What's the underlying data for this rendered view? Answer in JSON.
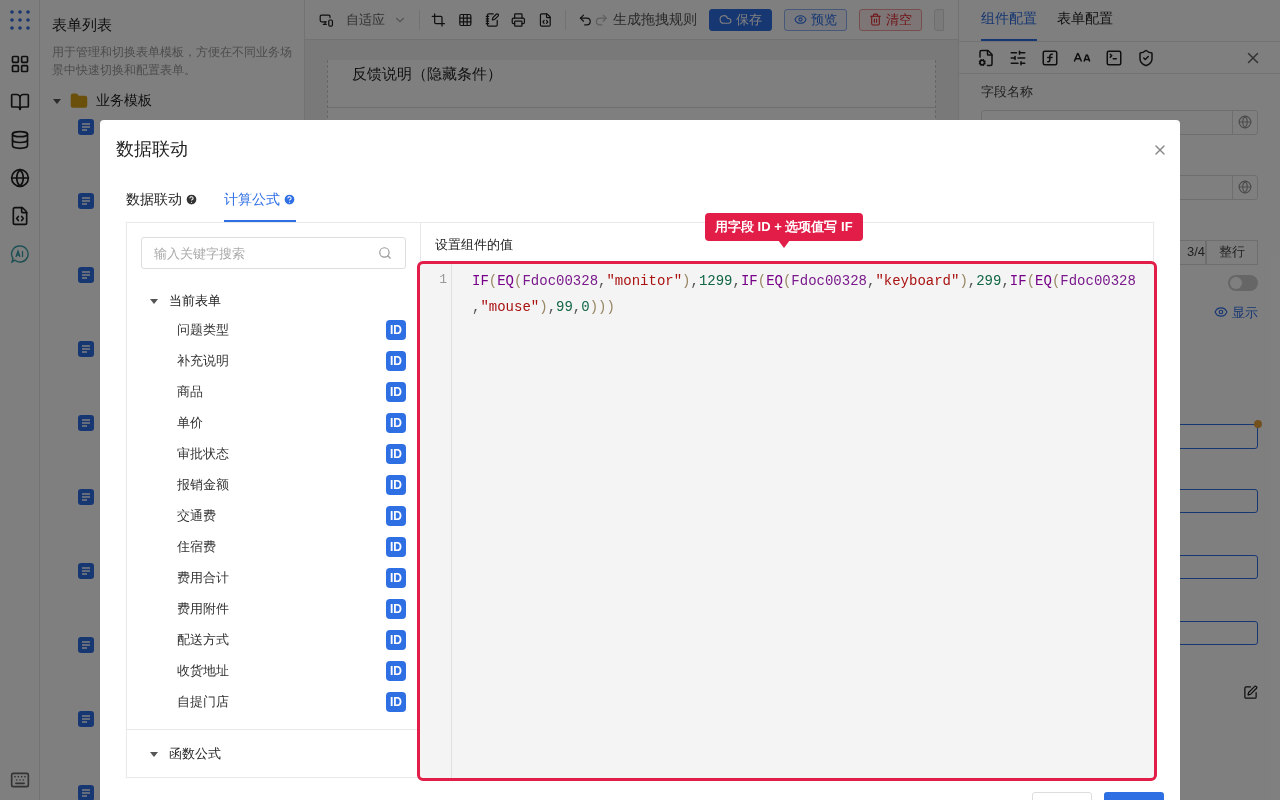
{
  "sidebar": {
    "title": "表单列表",
    "description": "用于管理和切换表单模板，方便在不同业务场景中快速切换和配置表单。",
    "tree": [
      {
        "label": "业务模板",
        "expanded": true,
        "children": [
          {
            "kind": "form"
          },
          {
            "kind": "form"
          },
          {
            "kind": "form"
          },
          {
            "kind": "form"
          },
          {
            "kind": "form"
          },
          {
            "kind": "form"
          },
          {
            "kind": "form"
          },
          {
            "kind": "form"
          },
          {
            "kind": "form"
          },
          {
            "kind": "form"
          }
        ]
      }
    ]
  },
  "toolbar": {
    "viewport": "自适应",
    "redo": {
      "disabled": true
    },
    "generate_rules": "生成拖拽规则",
    "buttons": [
      {
        "label": "保存",
        "kind": "primary"
      },
      {
        "label": "预览",
        "kind": "outline"
      },
      {
        "label": "清空",
        "kind": "danger"
      }
    ]
  },
  "canvas": {
    "field_title": "反馈说明（隐藏条件）"
  },
  "config_panel": {
    "tabs": [
      {
        "label": "组件配置",
        "selected": true
      },
      {
        "label": "表单配置",
        "selected": false
      }
    ],
    "field_name_label": "字段名称",
    "width_options": [
      {
        "label": "3/4",
        "selected": false
      },
      {
        "label": "整行",
        "selected": false
      }
    ],
    "toggle": {
      "on": false
    },
    "visibility_link": "显示"
  },
  "dialog": {
    "title": "数据联动",
    "tabs": [
      {
        "label": "数据联动",
        "selected": false
      },
      {
        "label": "计算公式",
        "selected": true
      }
    ],
    "search": {
      "placeholder": "输入关键字搜索"
    },
    "groups": [
      {
        "label": "当前表单",
        "expanded": true,
        "children": [
          {
            "label": "问题类型",
            "badge": "ID"
          },
          {
            "label": "补充说明",
            "badge": "ID"
          },
          {
            "label": "商品",
            "badge": "ID"
          },
          {
            "label": "单价",
            "badge": "ID"
          },
          {
            "label": "审批状态",
            "badge": "ID"
          },
          {
            "label": "报销金额",
            "badge": "ID"
          },
          {
            "label": "交通费",
            "badge": "ID"
          },
          {
            "label": "住宿费",
            "badge": "ID"
          },
          {
            "label": "费用合计",
            "badge": "ID"
          },
          {
            "label": "费用附件",
            "badge": "ID"
          },
          {
            "label": "配送方式",
            "badge": "ID"
          },
          {
            "label": "收货地址",
            "badge": "ID"
          },
          {
            "label": "自提门店",
            "badge": "ID"
          }
        ]
      },
      {
        "label": "函数公式",
        "expanded": true
      }
    ],
    "editor": {
      "label": "设置组件的值",
      "line_numbers": [
        "1"
      ],
      "tokens": [
        {
          "kind": "function",
          "text": "IF"
        },
        {
          "kind": "paren",
          "text": "("
        },
        {
          "kind": "function",
          "text": "EQ"
        },
        {
          "kind": "paren",
          "text": "("
        },
        {
          "kind": "field",
          "text": "Fdoc00328"
        },
        {
          "kind": "punct",
          "text": ","
        },
        {
          "kind": "string",
          "text": "\"monitor\""
        },
        {
          "kind": "paren",
          "text": ")"
        },
        {
          "kind": "punct",
          "text": ","
        },
        {
          "kind": "number",
          "text": "1299"
        },
        {
          "kind": "punct",
          "text": ","
        },
        {
          "kind": "function",
          "text": "IF"
        },
        {
          "kind": "paren",
          "text": "("
        },
        {
          "kind": "function",
          "text": "EQ"
        },
        {
          "kind": "paren",
          "text": "("
        },
        {
          "kind": "field",
          "text": "Fdoc00328"
        },
        {
          "kind": "punct",
          "text": ","
        },
        {
          "kind": "string",
          "text": "\"keyboard\""
        },
        {
          "kind": "paren",
          "text": ")"
        },
        {
          "kind": "punct",
          "text": ","
        },
        {
          "kind": "number",
          "text": "299"
        },
        {
          "kind": "punct",
          "text": ","
        },
        {
          "kind": "function",
          "text": "IF"
        },
        {
          "kind": "paren",
          "text": "("
        },
        {
          "kind": "function",
          "text": "EQ"
        },
        {
          "kind": "paren",
          "text": "("
        },
        {
          "kind": "field",
          "text": "Fdoc00328"
        },
        {
          "kind": "punct",
          "text": ","
        },
        {
          "kind": "string",
          "text": "\"mouse\""
        },
        {
          "kind": "paren",
          "text": ")"
        },
        {
          "kind": "punct",
          "text": ","
        },
        {
          "kind": "number",
          "text": "99"
        },
        {
          "kind": "punct",
          "text": ","
        },
        {
          "kind": "number",
          "text": "0"
        },
        {
          "kind": "paren",
          "text": ")))"
        }
      ]
    },
    "callout": "用字段 ID + 选项值写 IF"
  }
}
